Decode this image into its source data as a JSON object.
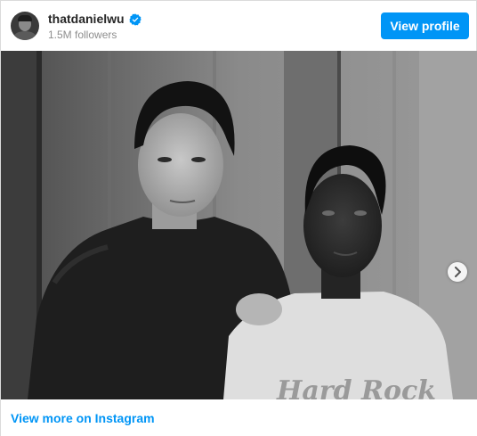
{
  "header": {
    "username": "thatdanielwu",
    "followers": "1.5M followers",
    "view_profile_label": "View profile"
  },
  "carousel": {
    "slide_count": 3,
    "active_index": 0
  },
  "footer": {
    "link_label": "View more on Instagram"
  },
  "colors": {
    "accent": "#0095f6",
    "text_primary": "#262626",
    "text_secondary": "#8e8e8e"
  },
  "icons": [
    "verified-badge-icon",
    "chevron-right-icon"
  ]
}
